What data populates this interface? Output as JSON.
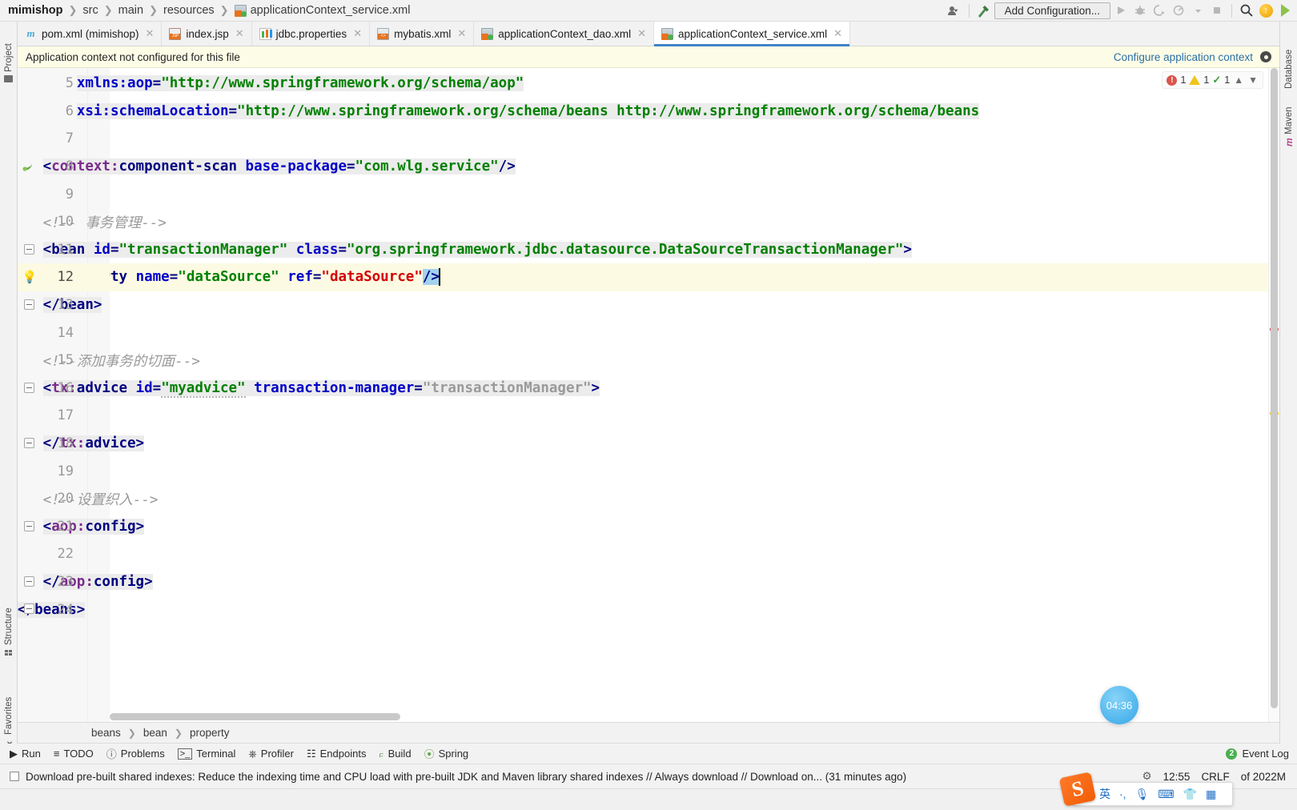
{
  "navbar": {
    "project": "mimishop",
    "crumbs": [
      "src",
      "main",
      "resources"
    ],
    "file": "applicationContext_service.xml",
    "add_configuration": "Add Configuration...",
    "icons": {
      "user_settings": "user-settings-icon",
      "build": "build-hammer-icon",
      "run": "run-icon",
      "debug": "debug-icon",
      "run_with_coverage": "run-with-coverage-icon",
      "profile": "profile-icon",
      "dropdown": "chevron-down-icon",
      "stop": "stop-icon",
      "search": "search-icon",
      "update": "update-icon",
      "ide_features": "ide-features-trainer-icon"
    }
  },
  "left_strip": {
    "items": [
      "Project",
      "Structure",
      "Favorites"
    ]
  },
  "right_strip": {
    "items": [
      "Database",
      "Maven"
    ]
  },
  "tabs": [
    {
      "label": "pom.xml (mimishop)",
      "icon": "maven-m-icon",
      "active": false
    },
    {
      "label": "index.jsp",
      "icon": "jsp-file-icon",
      "active": false
    },
    {
      "label": "jdbc.properties",
      "icon": "properties-file-icon",
      "active": false
    },
    {
      "label": "mybatis.xml",
      "icon": "xml-file-icon",
      "active": false
    },
    {
      "label": "applicationContext_dao.xml",
      "icon": "spring-xml-file-icon",
      "active": false
    },
    {
      "label": "applicationContext_service.xml",
      "icon": "spring-xml-file-icon",
      "active": true
    }
  ],
  "banner": {
    "message": "Application context not configured for this file",
    "action": "Configure application context",
    "gear_icon": "gear-icon"
  },
  "inspections": {
    "errors": "1",
    "warnings": "1",
    "typos": "1",
    "up_icon": "chevron-up-icon",
    "down_icon": "chevron-down-icon"
  },
  "editor": {
    "first_visible_line": 5,
    "caret_line": 12,
    "lines": [
      {
        "n": 5,
        "indent": 7,
        "segments": [
          {
            "t": "xmlns:aop",
            "c": "attr"
          },
          {
            "t": "=",
            "c": "punct"
          },
          {
            "t": "\"http://www.springframework.org/schema/aop\"",
            "c": "val"
          }
        ],
        "tagbg": true
      },
      {
        "n": 6,
        "indent": 7,
        "segments": [
          {
            "t": "xsi:schemaLocation",
            "c": "attr"
          },
          {
            "t": "=",
            "c": "punct"
          },
          {
            "t": "\"http://www.springframework.org/schema/beans http://www.springframework.org/schema/beans",
            "c": "val"
          }
        ],
        "tagbg": true
      },
      {
        "n": 7,
        "indent": 0,
        "segments": []
      },
      {
        "n": 8,
        "indent": 3,
        "segments": [
          {
            "t": "<",
            "c": "punct"
          },
          {
            "t": "context:",
            "c": "ns"
          },
          {
            "t": "component-scan",
            "c": "tagname"
          },
          {
            "t": " ",
            "c": "plain"
          },
          {
            "t": "base-package",
            "c": "attr"
          },
          {
            "t": "=",
            "c": "punct"
          },
          {
            "t": "\"com.wlg.service\"",
            "c": "val"
          },
          {
            "t": "/>",
            "c": "punct"
          }
        ],
        "tagbg": true,
        "gutter_icon": "spring-bean-icon"
      },
      {
        "n": 9,
        "indent": 0,
        "segments": []
      },
      {
        "n": 10,
        "indent": 3,
        "segments": [
          {
            "t": "<!-- 事务管理-->",
            "c": "cmt"
          }
        ]
      },
      {
        "n": 11,
        "indent": 3,
        "segments": [
          {
            "t": "<",
            "c": "punct"
          },
          {
            "t": "bean",
            "c": "tagname"
          },
          {
            "t": " ",
            "c": "plain"
          },
          {
            "t": "id",
            "c": "attr"
          },
          {
            "t": "=",
            "c": "punct"
          },
          {
            "t": "\"transactionManager\"",
            "c": "val"
          },
          {
            "t": " ",
            "c": "plain"
          },
          {
            "t": "class",
            "c": "attr"
          },
          {
            "t": "=",
            "c": "punct"
          },
          {
            "t": "\"org.springframework.jdbc.datasource.DataSourceTransactionManager\"",
            "c": "val"
          },
          {
            "t": ">",
            "c": "punct"
          }
        ],
        "tagbg": true,
        "fold": "minus"
      },
      {
        "n": 12,
        "indent": 4,
        "segments": [
          {
            "t": "<",
            "c": "punct brhl"
          },
          {
            "t": "property",
            "c": "tagname"
          },
          {
            "t": " ",
            "c": "plain"
          },
          {
            "t": "name",
            "c": "attr"
          },
          {
            "t": "=",
            "c": "punct"
          },
          {
            "t": "\"dataSource\"",
            "c": "val"
          },
          {
            "t": " ",
            "c": "plain"
          },
          {
            "t": "ref",
            "c": "attr"
          },
          {
            "t": "=",
            "c": "punct"
          },
          {
            "t": "\"dataSource\"",
            "c": "valred"
          },
          {
            "t": "/>",
            "c": "punct brhl"
          }
        ],
        "caret": true,
        "bulb": true
      },
      {
        "n": 13,
        "indent": 3,
        "segments": [
          {
            "t": "</",
            "c": "punct"
          },
          {
            "t": "bean",
            "c": "tagname"
          },
          {
            "t": ">",
            "c": "punct"
          }
        ],
        "tagbg": true,
        "fold": "minus-bottom"
      },
      {
        "n": 14,
        "indent": 0,
        "segments": []
      },
      {
        "n": 15,
        "indent": 3,
        "segments": [
          {
            "t": "<!--添加事务的切面-->",
            "c": "cmt"
          }
        ]
      },
      {
        "n": 16,
        "indent": 3,
        "segments": [
          {
            "t": "<",
            "c": "punct"
          },
          {
            "t": "tx:",
            "c": "ns"
          },
          {
            "t": "advice",
            "c": "tagname"
          },
          {
            "t": " ",
            "c": "plain"
          },
          {
            "t": "id",
            "c": "attr"
          },
          {
            "t": "=",
            "c": "punct"
          },
          {
            "t": "\"myadvice\"",
            "c": "val squig"
          },
          {
            "t": " ",
            "c": "plain"
          },
          {
            "t": "transaction-manager",
            "c": "attr"
          },
          {
            "t": "=",
            "c": "punct"
          },
          {
            "t": "\"transactionManager\"",
            "c": "valgray"
          },
          {
            "t": ">",
            "c": "punct"
          }
        ],
        "tagbg": true,
        "fold": "minus"
      },
      {
        "n": 17,
        "indent": 0,
        "segments": []
      },
      {
        "n": 18,
        "indent": 3,
        "segments": [
          {
            "t": "</",
            "c": "punct"
          },
          {
            "t": "tx:",
            "c": "ns"
          },
          {
            "t": "advice",
            "c": "tagname"
          },
          {
            "t": ">",
            "c": "punct"
          }
        ],
        "tagbg": true,
        "fold": "minus-bottom"
      },
      {
        "n": 19,
        "indent": 0,
        "segments": []
      },
      {
        "n": 20,
        "indent": 3,
        "segments": [
          {
            "t": "<!--设置织入-->",
            "c": "cmt"
          }
        ]
      },
      {
        "n": 21,
        "indent": 3,
        "segments": [
          {
            "t": "<",
            "c": "punct"
          },
          {
            "t": "aop:",
            "c": "ns"
          },
          {
            "t": "config",
            "c": "tagname"
          },
          {
            "t": ">",
            "c": "punct"
          }
        ],
        "tagbg": true,
        "fold": "minus"
      },
      {
        "n": 22,
        "indent": 0,
        "segments": []
      },
      {
        "n": 23,
        "indent": 3,
        "segments": [
          {
            "t": "</",
            "c": "punct"
          },
          {
            "t": "aop:",
            "c": "ns"
          },
          {
            "t": "config",
            "c": "tagname"
          },
          {
            "t": ">",
            "c": "punct"
          }
        ],
        "tagbg": true,
        "fold": "minus-bottom"
      },
      {
        "n": 24,
        "indent": 0,
        "segments": [
          {
            "t": "</",
            "c": "punct"
          },
          {
            "t": "beans",
            "c": "tagname"
          },
          {
            "t": ">",
            "c": "punct"
          }
        ],
        "tagbg": true,
        "fold": "minus-bottom"
      }
    ]
  },
  "editor_breadcrumb": [
    "beans",
    "bean",
    "property"
  ],
  "tool_window_bar": {
    "items": [
      {
        "label": "Run",
        "icon": "run-icon"
      },
      {
        "label": "TODO",
        "icon": "todo-list-icon"
      },
      {
        "label": "Problems",
        "icon": "problems-icon"
      },
      {
        "label": "Terminal",
        "icon": "terminal-icon"
      },
      {
        "label": "Profiler",
        "icon": "profiler-icon"
      },
      {
        "label": "Endpoints",
        "icon": "endpoints-icon"
      },
      {
        "label": "Build",
        "icon": "build-hammer-icon"
      },
      {
        "label": "Spring",
        "icon": "spring-leaf-icon"
      }
    ],
    "event_log": "Event Log",
    "event_log_badge": "2"
  },
  "statusbar": {
    "message": "Download pre-built shared indexes: Reduce the indexing time and CPU load with pre-built JDK and Maven library shared indexes // Always download // Download on... (31 minutes ago)",
    "checkbox_icon": "notification-icon",
    "caret_position": "12:55",
    "line_separator": "CRLF",
    "encoding_and_memory": "of 2022M",
    "indent_icon": "indent-icon"
  },
  "overlays": {
    "ime": {
      "logo_text": "S",
      "mode": "英",
      "items": [
        "英",
        "·,",
        "mic-icon",
        "keyboard-icon",
        "skin-icon",
        "toolbox-icon"
      ]
    },
    "timer": "04:36"
  },
  "colors": {
    "accent": "#4083c9",
    "banner_bg": "#fdfde7",
    "link": "#2a6fa8",
    "error": "#d9544d",
    "warning": "#f0c419",
    "ok": "#3c9e3c",
    "string": "#008000",
    "attribute": "#0000c8",
    "tag": "#000080",
    "namespace": "#7a2b8c",
    "value_red": "#d40000",
    "comment": "#9a9a9a"
  }
}
